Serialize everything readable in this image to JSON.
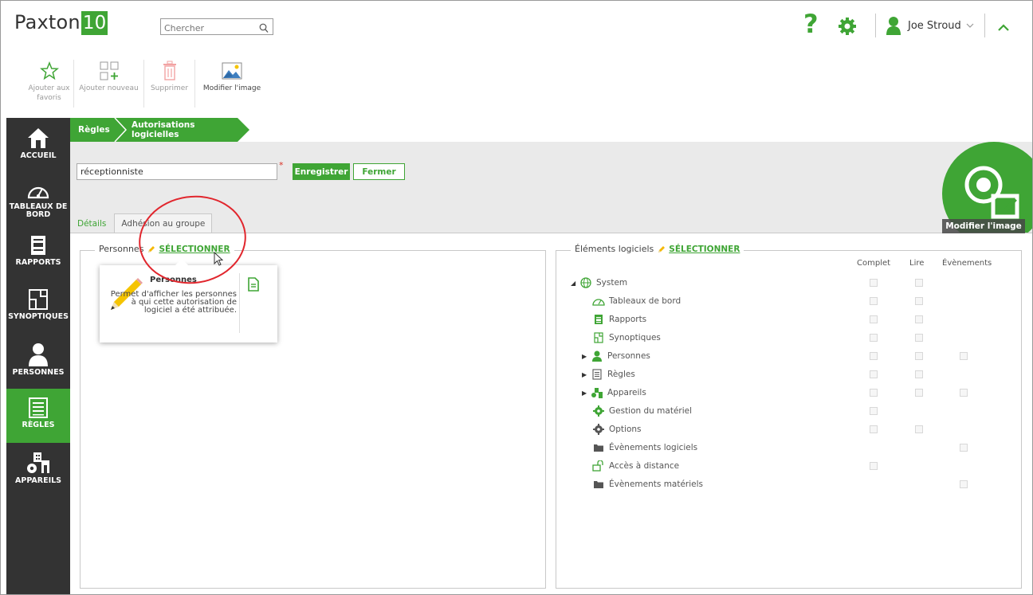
{
  "app": {
    "logo_text": "Paxton",
    "logo_badge": "10"
  },
  "search": {
    "placeholder": "Chercher"
  },
  "header": {
    "help_label": "?",
    "user_name": "Joe Stroud"
  },
  "toolbar": {
    "add_favorite": "Ajouter aux\nfavoris",
    "add_new": "Ajouter nouveau",
    "delete": "Supprimer",
    "modify_image": "Modifier l'image"
  },
  "sidebar": {
    "items": [
      {
        "label": "ACCUEIL",
        "icon": "home-icon"
      },
      {
        "label": "TABLEAUX DE\nBORD",
        "icon": "dashboard-icon"
      },
      {
        "label": "RAPPORTS",
        "icon": "reports-icon"
      },
      {
        "label": "SYNOPTIQUES",
        "icon": "synoptics-icon"
      },
      {
        "label": "PERSONNES",
        "icon": "person-icon"
      },
      {
        "label": "RÈGLES",
        "icon": "rules-icon"
      },
      {
        "label": "APPAREILS",
        "icon": "devices-icon"
      }
    ],
    "active_index": 5
  },
  "breadcrumb": {
    "root": "Règles",
    "current": "Autorisations logicielles"
  },
  "form": {
    "name_value": "réceptionniste",
    "required_mark": "*",
    "save_label": "Enregistrer",
    "close_label": "Fermer"
  },
  "tabs": {
    "details": "Détails",
    "group": "Adhésion au groupe"
  },
  "avatar": {
    "modify_label": "Modifier l'image"
  },
  "left_panel": {
    "legend": "Personnes",
    "select_label": "SÉLECTIONNER"
  },
  "popup": {
    "title": "Personnes",
    "description": "Permet d'afficher les personnes à qui cette autorisation de logiciel a été attribuée."
  },
  "right_panel": {
    "legend": "Éléments logiciels",
    "select_label": "SÉLECTIONNER",
    "columns": [
      "Complet",
      "Lire",
      "Évènements"
    ],
    "tree": [
      {
        "label": "System",
        "icon": "globe-icon"
      },
      {
        "label": "Tableaux de bord",
        "icon": "dashboard-icon"
      },
      {
        "label": "Rapports",
        "icon": "reports-icon"
      },
      {
        "label": "Synoptiques",
        "icon": "synoptics-icon"
      },
      {
        "label": "Personnes",
        "icon": "person-icon"
      },
      {
        "label": "Règles",
        "icon": "rules-icon"
      },
      {
        "label": "Appareils",
        "icon": "devices-icon"
      },
      {
        "label": "Gestion du matériel",
        "icon": "gear-icon"
      },
      {
        "label": "Options",
        "icon": "options-gear-icon"
      },
      {
        "label": "Évènements logiciels",
        "icon": "folder-icon"
      },
      {
        "label": "Accès à distance",
        "icon": "remote-icon"
      },
      {
        "label": "Évènements matériels",
        "icon": "folder-icon"
      }
    ]
  },
  "colors": {
    "accent": "#3fa535",
    "sidebar_bg": "#333333",
    "annotation": "#e1262d"
  }
}
